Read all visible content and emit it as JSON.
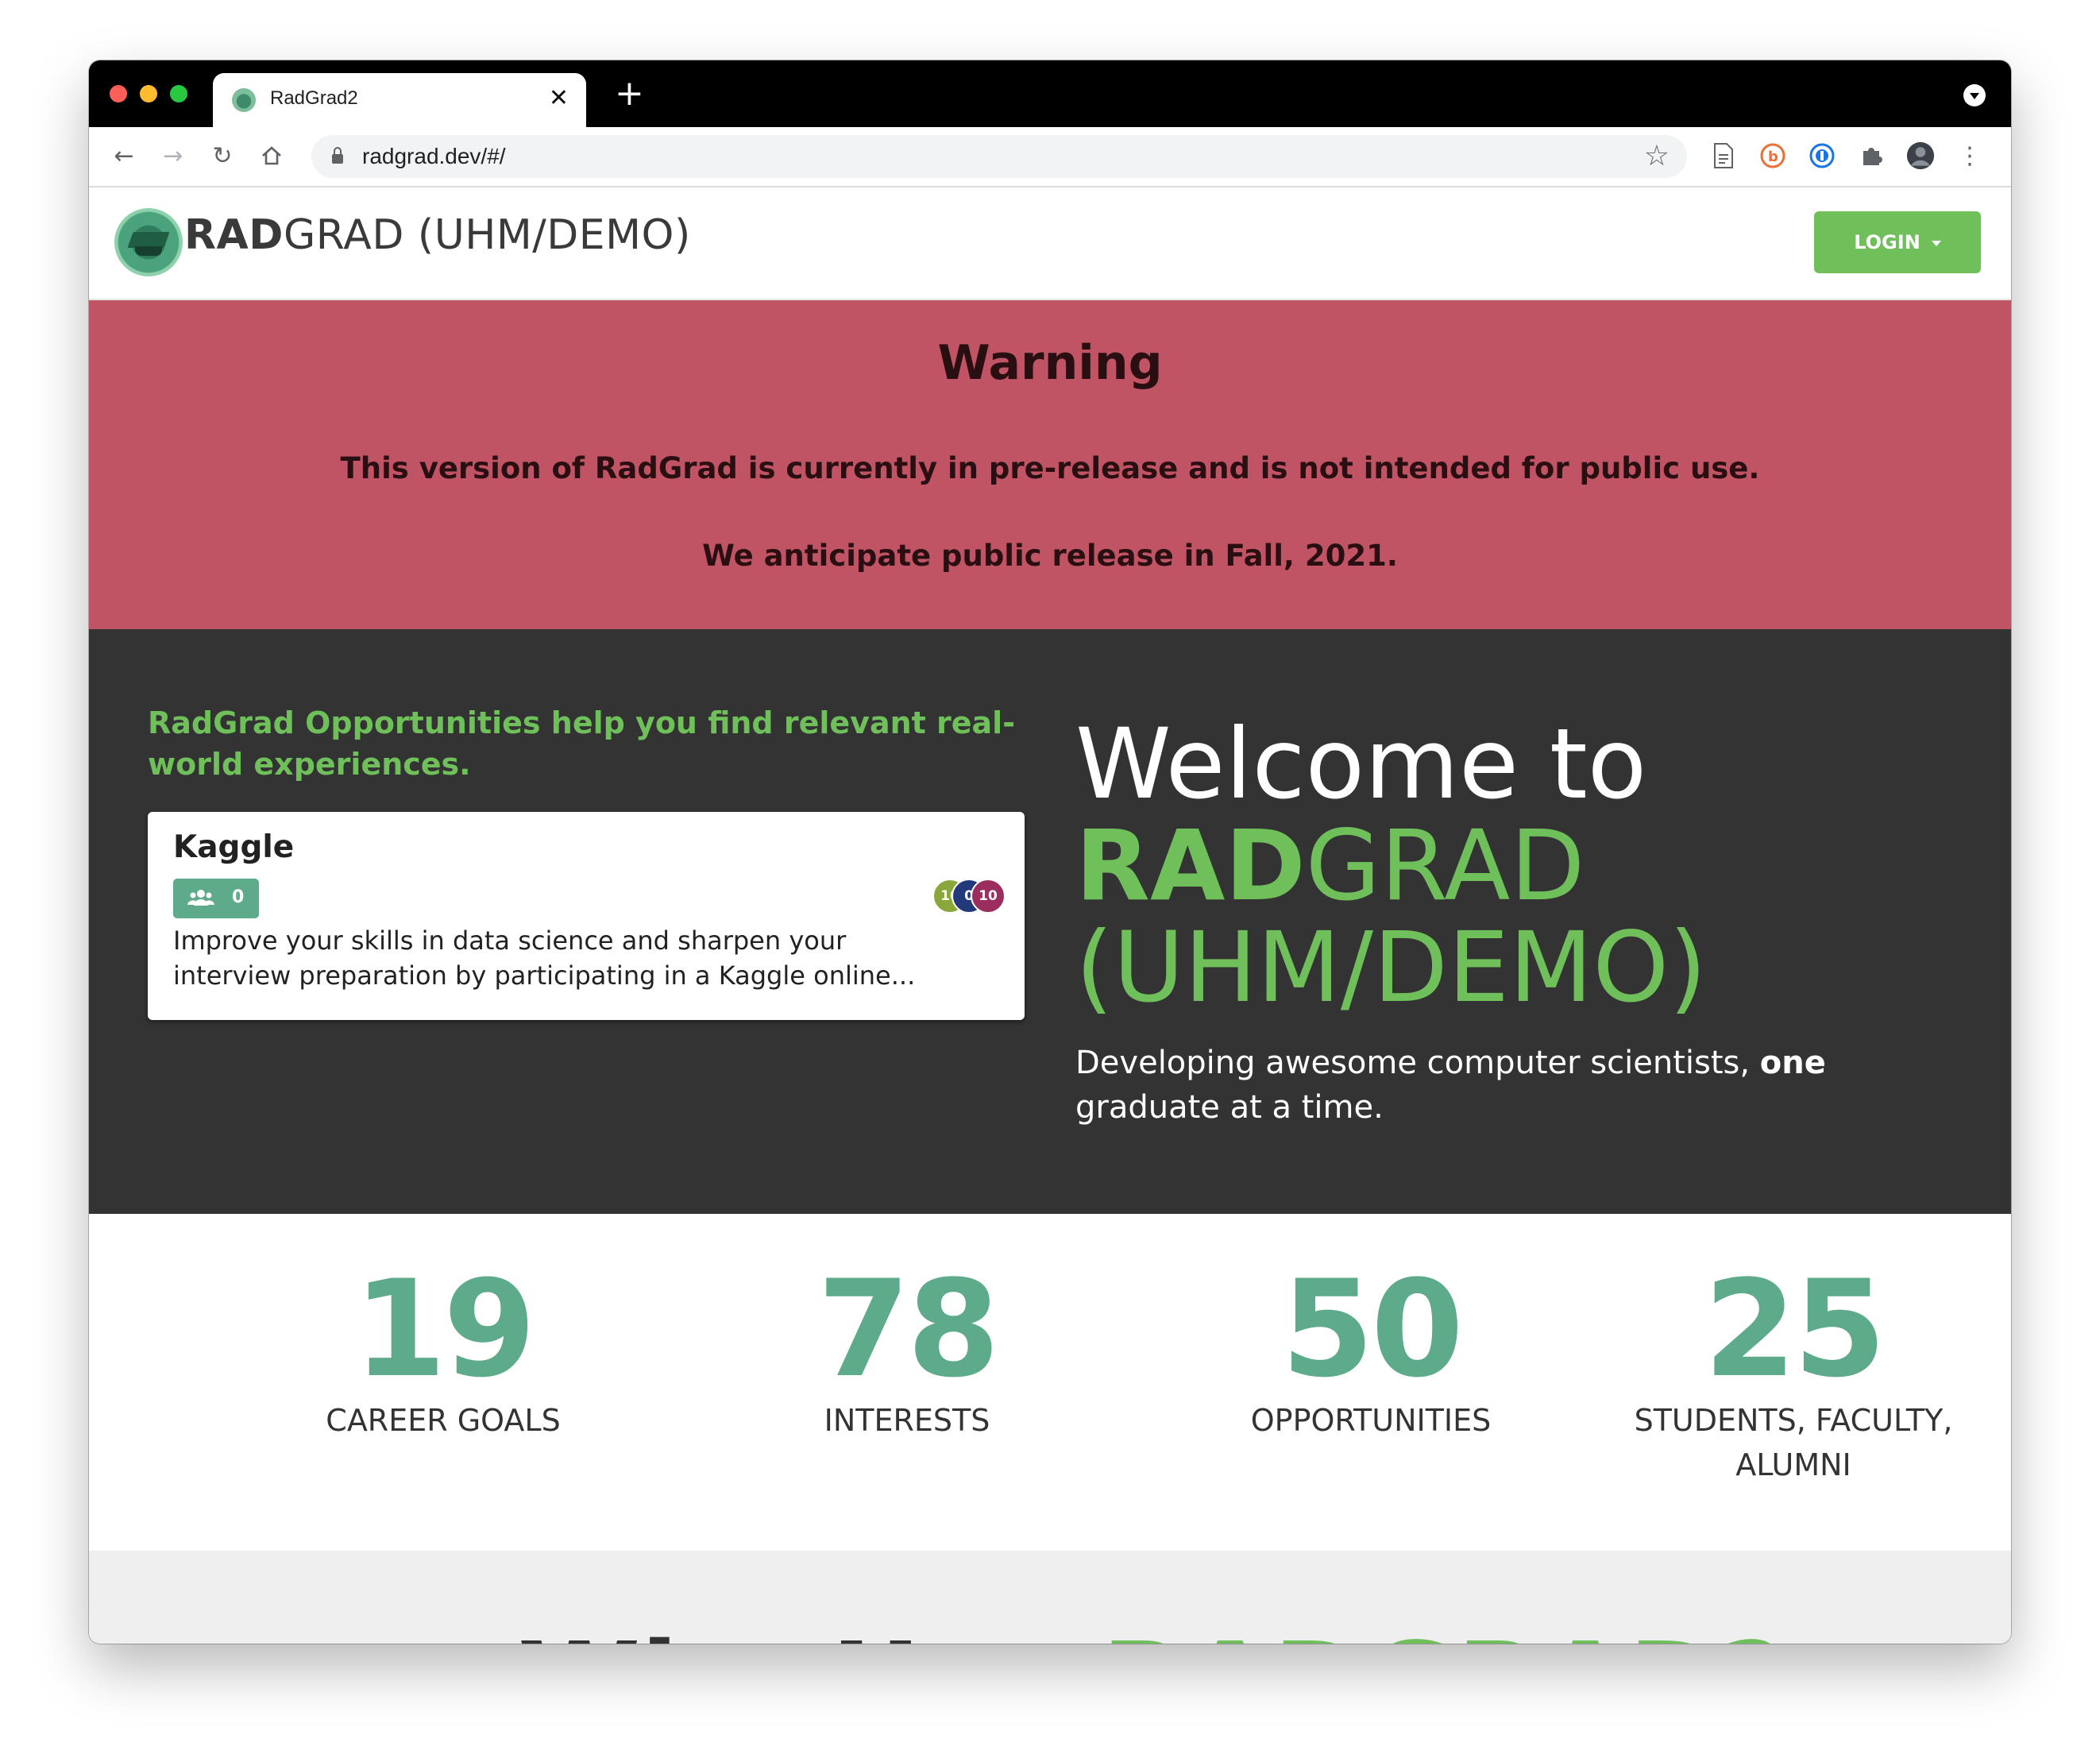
{
  "browser": {
    "tab_title": "RadGrad2",
    "url": "radgrad.dev/#/"
  },
  "navbar": {
    "brand_bold": "RAD",
    "brand_rest": "GRAD (UHM/DEMO)",
    "login_label": "LOGIN"
  },
  "warning": {
    "title": "Warning",
    "line1": "This version of RadGrad is currently in pre-release and is not intended for public use.",
    "line2": "We anticipate public release in Fall, 2021."
  },
  "hero": {
    "opportunities_heading": "RadGrad Opportunities help you find relevant real-world experiences.",
    "card": {
      "title": "Kaggle",
      "participants": "0",
      "description": "Improve your skills in data science and sharpen your interview preparation by participating in a Kaggle online...",
      "points": [
        {
          "value": "10",
          "color": "#8aa83a"
        },
        {
          "value": "0",
          "color": "#233a7a"
        },
        {
          "value": "10",
          "color": "#9b2e5e"
        }
      ]
    },
    "welcome_line1": "Welcome to",
    "welcome_bold": "RAD",
    "welcome_rest": "GRAD",
    "welcome_line3": "(UHM/DEMO)",
    "tagline_pre": "Developing awesome computer scientists, ",
    "tagline_bold": "one",
    "tagline_post": " graduate at a time."
  },
  "stats": [
    {
      "number": "19",
      "label": "CAREER GOALS"
    },
    {
      "number": "78",
      "label": "INTERESTS"
    },
    {
      "number": "50",
      "label": "OPPORTUNITIES"
    },
    {
      "number": "25",
      "label": "STUDENTS, FACULTY, ALUMNI"
    }
  ],
  "bottom": {
    "title_pre": "Why Use ",
    "title_accent": "RADGRAD?"
  },
  "colors": {
    "accent_green": "#6fbf5a",
    "teal": "#5eab8c",
    "warning_bg": "#c05464",
    "hero_bg": "#333333"
  }
}
